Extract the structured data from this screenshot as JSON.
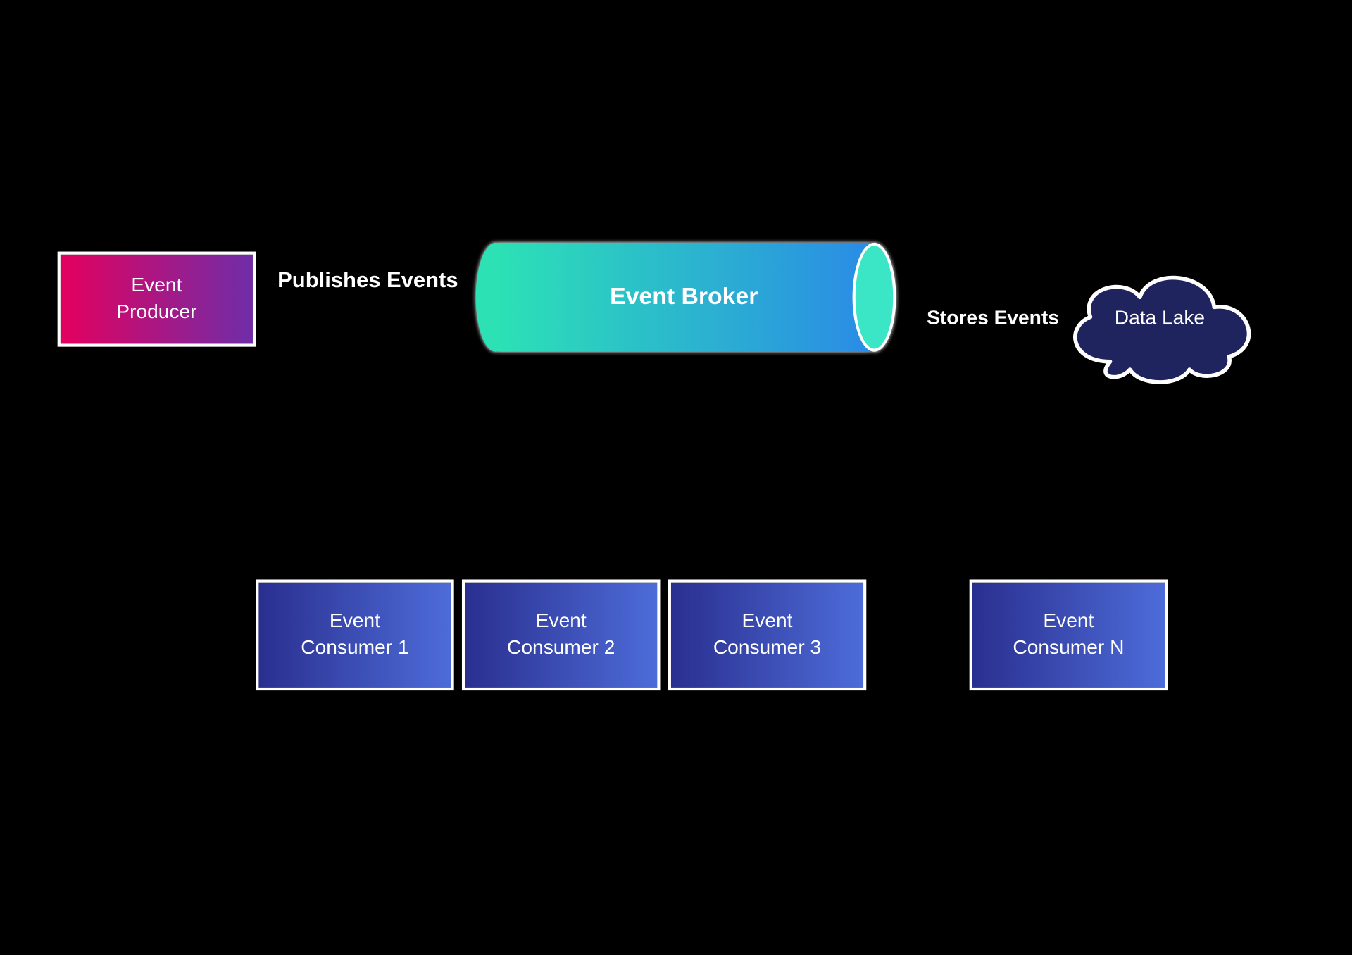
{
  "producer": {
    "label": "Event\nProducer"
  },
  "publish_label": "Publishes Events",
  "broker": {
    "label": "Event Broker"
  },
  "store_label": "Stores Events",
  "data_lake": {
    "label": "Data Lake"
  },
  "consumers": [
    {
      "label": "Event\nConsumer 1"
    },
    {
      "label": "Event\nConsumer 2"
    },
    {
      "label": "Event\nConsumer 3"
    },
    {
      "label": "Event\nConsumer N"
    }
  ]
}
